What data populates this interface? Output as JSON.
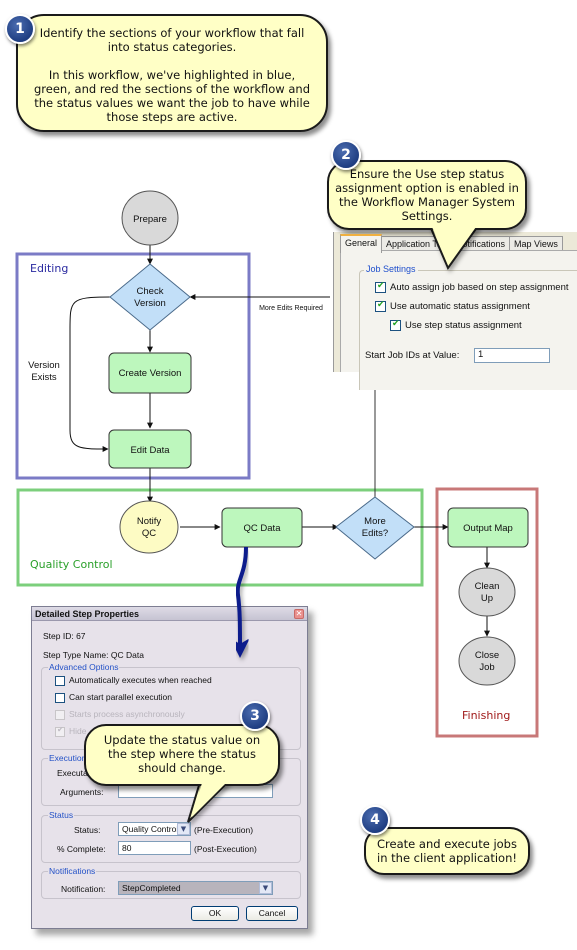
{
  "callouts": [
    {
      "number": "1",
      "lines": [
        "Identify the sections of your workflow that fall",
        "into status categories.",
        "",
        "In this workflow, we've highlighted in blue,",
        "green, and red the sections of the workflow and",
        "the status values we want the job to have while",
        "those steps are active."
      ]
    },
    {
      "number": "2",
      "lines": [
        "Ensure the Use step status",
        "assignment option is enabled in",
        "the Workflow Manager System",
        "Settings."
      ]
    },
    {
      "number": "3",
      "lines": [
        "Update the status value on",
        "the step where the status",
        "should change."
      ]
    },
    {
      "number": "4",
      "lines": [
        "Create and execute jobs",
        "in the client application!"
      ]
    }
  ],
  "workflow": {
    "regions": {
      "editing": {
        "label": "Editing",
        "color": "#7b7bc6"
      },
      "quality_control": {
        "label": "Quality Control",
        "color": "#7ccf7c"
      },
      "finishing": {
        "label": "Finishing",
        "color": "#c87878"
      }
    },
    "nodes": {
      "prepare": "Prepare",
      "check_version": [
        "Check",
        "Version"
      ],
      "create_version": "Create Version",
      "edit_data": "Edit Data",
      "notify_qc": [
        "Notify",
        "QC"
      ],
      "qc_data": "QC Data",
      "more_edits": [
        "More",
        "Edits?"
      ],
      "output_map": "Output Map",
      "clean_up": [
        "Clean",
        "Up"
      ],
      "close_job": [
        "Close",
        "Job"
      ]
    },
    "edge_labels": {
      "version_exists": [
        "Version",
        "Exists"
      ],
      "more_edits_required": "More Edits Required"
    }
  },
  "system_settings": {
    "tabs": [
      "General",
      "Application Tabs",
      "Notifications",
      "Map Views"
    ],
    "active_tab": "General",
    "group_label": "Job Settings",
    "options": [
      {
        "label": "Auto assign job based on step assignment",
        "checked": true
      },
      {
        "label": "Use automatic status assignment",
        "checked": true
      },
      {
        "label": "Use step status assignment",
        "checked": true
      }
    ],
    "start_job_ids_label": "Start Job IDs at Value:",
    "start_job_ids_value": "1"
  },
  "step_dialog": {
    "title": "Detailed Step Properties",
    "close_icon": "close-icon",
    "step_id": "Step ID: 67",
    "step_type_name": "Step Type Name: QC Data",
    "advanced_options": {
      "label": "Advanced Options",
      "options": [
        {
          "label": "Automatically executes when reached",
          "checked": false,
          "enabled": true
        },
        {
          "label": "Can start parallel execution",
          "checked": false,
          "enabled": true
        },
        {
          "label": "Starts process asynchronously",
          "checked": false,
          "enabled": false
        },
        {
          "label": "Hide",
          "checked": true,
          "enabled": false
        }
      ]
    },
    "execution": {
      "label": "Execution",
      "executable_label": "Executa",
      "arguments_label": "Arguments:",
      "arguments_value": ""
    },
    "status": {
      "label": "Status",
      "status_label": "Status:",
      "status_value": "Quality Control",
      "status_note": "(Pre-Execution)",
      "complete_label": "% Complete:",
      "complete_value": "80",
      "complete_note": "(Post-Execution)"
    },
    "notifications": {
      "label": "Notifications",
      "notification_label": "Notification:",
      "notification_value": "StepCompleted"
    },
    "ok_label": "OK",
    "cancel_label": "Cancel"
  }
}
